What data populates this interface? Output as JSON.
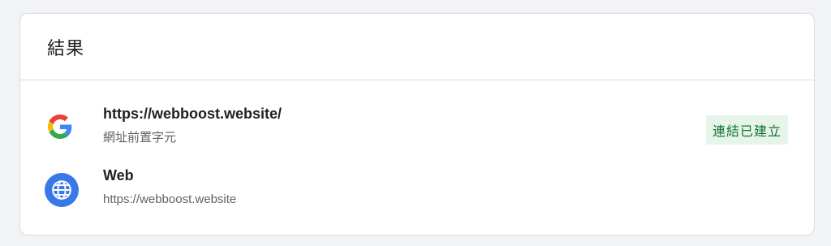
{
  "card": {
    "title": "結果"
  },
  "rows": [
    {
      "icon": "google-icon",
      "title": "https://webboost.website/",
      "subtitle": "網址前置字元",
      "badge": "連結已建立"
    },
    {
      "icon": "globe-icon",
      "title": "Web",
      "subtitle": "https://webboost.website"
    }
  ],
  "colors": {
    "badge_bg": "#e6f4ea",
    "badge_text": "#137333",
    "web_icon_bg": "#3b78e7"
  }
}
